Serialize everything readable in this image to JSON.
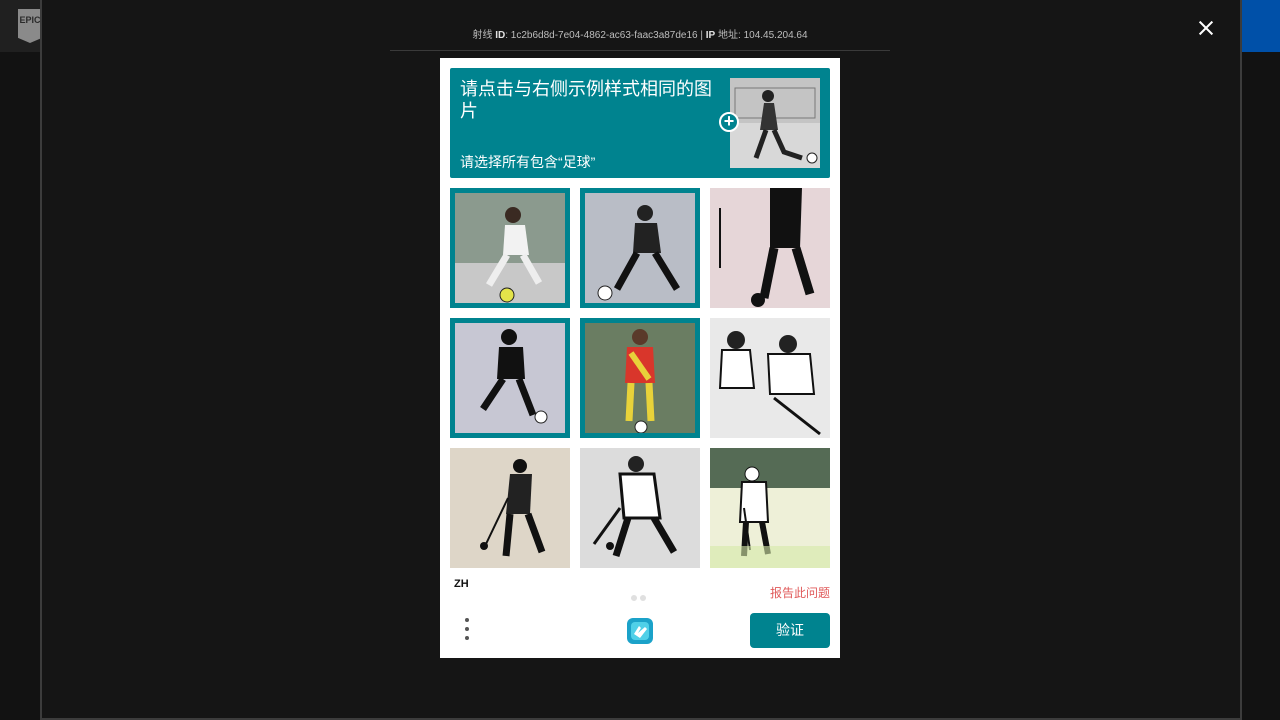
{
  "topbar": {
    "logo_text": "EPIC"
  },
  "overlay": {
    "ray_label": "射线",
    "ray_id_key": "ID",
    "ray_id": "1c2b6d8d-7e04-4862-ac63-faac3a87de16",
    "ip_key": "IP",
    "ip_label": "地址",
    "ip": "104.45.204.64"
  },
  "captcha": {
    "prompt_title": "请点击与右侧示例样式相同的图片",
    "prompt_sub": "请选择所有包含“足球”",
    "language": "ZH",
    "report": "报告此问题",
    "verify": "验证",
    "accent_color": "#00838f",
    "tiles": [
      {
        "subject": "soccer player kicking ball",
        "selected": true
      },
      {
        "subject": "soccer player kicking ball",
        "selected": true
      },
      {
        "subject": "golfer",
        "selected": false
      },
      {
        "subject": "soccer player dribbling",
        "selected": true
      },
      {
        "subject": "soccer player in red yellow kit",
        "selected": true
      },
      {
        "subject": "hockey players",
        "selected": false
      },
      {
        "subject": "golfer putting",
        "selected": false
      },
      {
        "subject": "field hockey player",
        "selected": false
      },
      {
        "subject": "golfer on green",
        "selected": false
      }
    ]
  }
}
